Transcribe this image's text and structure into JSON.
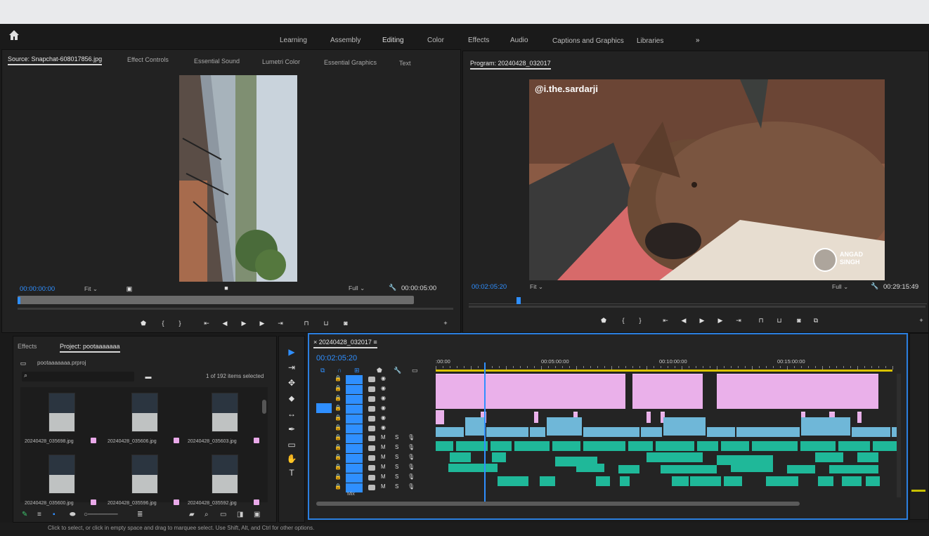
{
  "app": {
    "workspaces": [
      "Learning",
      "Assembly",
      "Editing",
      "Color",
      "Effects",
      "Audio",
      "Captions and Graphics",
      "Libraries"
    ],
    "overflow_icon": "chevron-double-right-icon"
  },
  "source_panel": {
    "tabs": [
      "Source: Snapchat-608017856.jpg",
      "Effect Controls",
      "Essential Sound",
      "Lumetri Color",
      "Essential Graphics",
      "Text"
    ],
    "timecode_in": "00:00:00:00",
    "fit": "Fit",
    "quality": "Full",
    "duration": "00:00:05:00"
  },
  "program_panel": {
    "title": "Program: 20240428_032017",
    "timecode": "00:02:05:20",
    "fit": "Fit",
    "quality": "Full",
    "duration": "00:29:15:49",
    "watermark": "@i.the.sardarji",
    "logo_text": "ANGAD\nSINGH"
  },
  "project_panel": {
    "tabs": [
      "Effects",
      "Project: pootaaaaaaa"
    ],
    "project_file": "pootaaaaaaa.prproj",
    "selection": "1 of 192 items selected",
    "items": [
      {
        "name": "20240428_035698.jpg"
      },
      {
        "name": "20240428_035606.jpg"
      },
      {
        "name": "20240428_035603.jpg"
      },
      {
        "name": "20240428_035600.jpg"
      },
      {
        "name": "20240428_035596.jpg"
      },
      {
        "name": "20240428_035592.jpg"
      }
    ]
  },
  "timeline": {
    "sequence": "20240428_032017",
    "timecode": "00:02:05:20",
    "ruler": [
      ":00:00",
      "00:05:00:00",
      "00:10:00:00",
      "00:15:00:00"
    ],
    "mix_label": "Mix"
  },
  "statusbar": {
    "hint": "Click to select, or click in empty space and drag to marquee select. Use Shift, Alt, and Ctrl for other options."
  }
}
